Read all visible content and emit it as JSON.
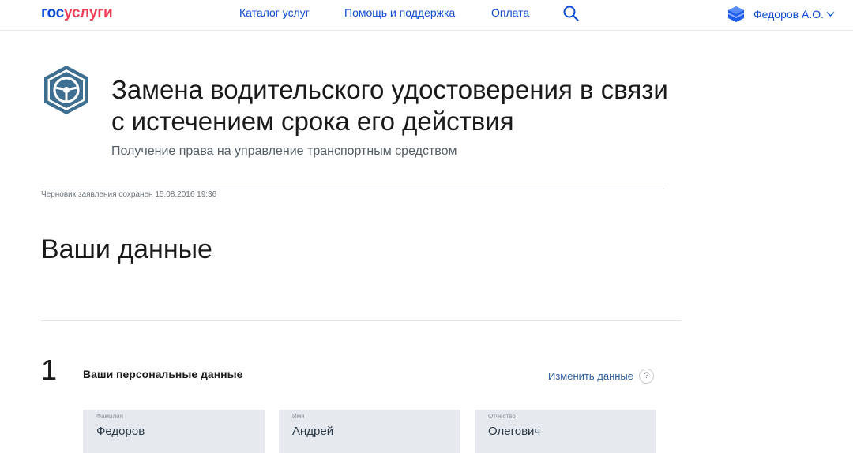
{
  "header": {
    "logo_part1": "гос",
    "logo_part2": "услуги",
    "nav": {
      "catalog": "Каталог услуг",
      "help": "Помощь и поддержка",
      "payment": "Оплата"
    },
    "user_name": "Федоров А.О."
  },
  "service": {
    "title": "Замена водительского удостоверения в связи с истечением срока его действия",
    "subtitle": "Получение права на управление транспортным средством",
    "draft_note": "Черновик заявления сохранен 15.08.2016 19:36"
  },
  "section": {
    "title": "Ваши данные"
  },
  "step": {
    "number": "1",
    "title": "Ваши персональные данные",
    "edit_label": "Изменить данные",
    "help_label": "?"
  },
  "fields": {
    "surname": {
      "label": "Фамилия",
      "value": "Федоров"
    },
    "name": {
      "label": "Имя",
      "value": "Андрей"
    },
    "patronymic": {
      "label": "Отчество",
      "value": "Олегович"
    }
  },
  "colors": {
    "brand_blue": "#0d4cd3",
    "brand_red": "#ee3f58",
    "service_icon": "#3e6f91",
    "field_bg": "#e6eaee"
  },
  "icons": {
    "search": "search-icon",
    "user": "user-avatar-icon",
    "chevron": "chevron-down-icon",
    "service": "steering-wheel-icon"
  }
}
